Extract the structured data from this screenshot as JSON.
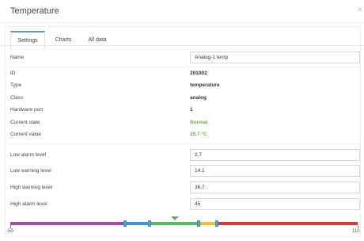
{
  "dialog": {
    "title": "Temperature"
  },
  "tabs": [
    {
      "label": "Settings",
      "active": true
    },
    {
      "label": "Charts",
      "active": false
    },
    {
      "label": "All data",
      "active": false
    }
  ],
  "fields": {
    "name": {
      "label": "Name",
      "value": "Analog-1 temp"
    },
    "id": {
      "label": "ID",
      "value": "201002"
    },
    "type": {
      "label": "Type",
      "value": "temperature"
    },
    "class": {
      "label": "Class",
      "value": "analog"
    },
    "hardware_port": {
      "label": "Hardware port",
      "value": "1"
    },
    "current_state": {
      "label": "Current state",
      "value": "Normal"
    },
    "current_value": {
      "label": "Current value",
      "value": "25.7 °C"
    }
  },
  "levels": {
    "low_alarm": {
      "label": "Low alarm level",
      "value": "2.7"
    },
    "low_warning": {
      "label": "Low warning level",
      "value": "14.1"
    },
    "high_warning": {
      "label": "High warning level",
      "value": "36.7"
    },
    "high_alarm": {
      "label": "High alarm level",
      "value": "45"
    }
  },
  "scale": {
    "min_label": "-50",
    "max_label": "110",
    "min": -50,
    "max": 110,
    "current": 25.7,
    "thresholds": [
      2.7,
      14.1,
      36.7,
      45
    ],
    "colors": {
      "alarm_low": "#a64ca6",
      "warning_low": "#4a90d9",
      "normal": "#5cb85c",
      "warning_high": "#f0c030",
      "alarm_high": "#d03c3c",
      "marker": "#6ab04c",
      "state_normal": "#6ab04c",
      "tab_accent": "#4a9fd8"
    }
  }
}
